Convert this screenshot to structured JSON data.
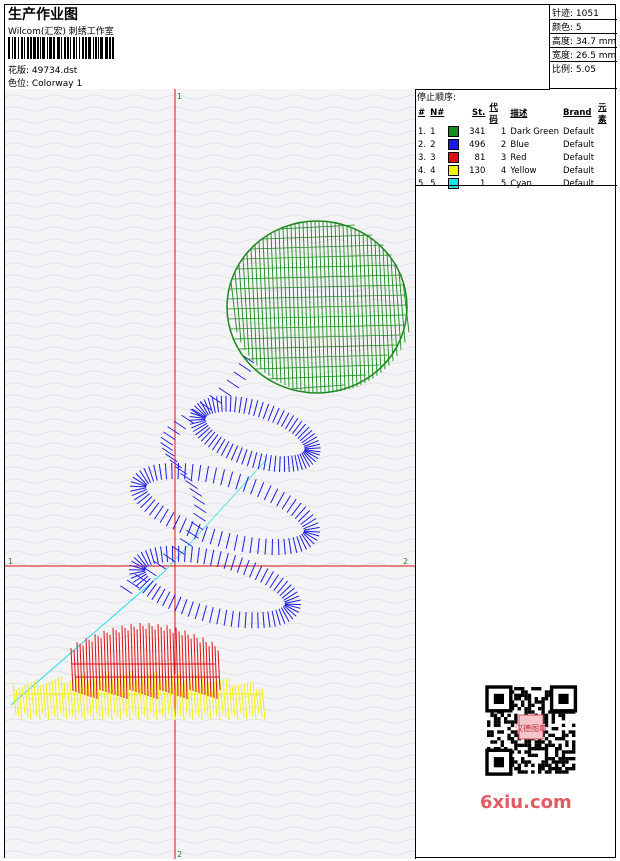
{
  "header": {
    "title": "生产作业图",
    "studio": "Wilcom(汇宏) 刺绣工作室",
    "design_label": "花版: 49734.dst",
    "colorway_label": "色位: Colorway 1"
  },
  "stats": [
    {
      "text": "针迹: 1051"
    },
    {
      "text": "颜色: 5"
    },
    {
      "text": "高度: 34.7 mm"
    },
    {
      "text": "宽度: 26.5 mm"
    },
    {
      "text": "比例: 5.05"
    }
  ],
  "stop_sequence": {
    "title": "停止顺序:",
    "columns": [
      "#",
      "N#",
      "St.",
      "代码",
      "描述",
      "Brand",
      "元素"
    ],
    "rows": [
      {
        "idx": "1.",
        "n": "1",
        "color": "#1a8a1a",
        "st": "341",
        "code": "1",
        "desc": "Dark Green",
        "brand": "Default"
      },
      {
        "idx": "2.",
        "n": "2",
        "color": "#1c1ce0",
        "st": "496",
        "code": "2",
        "desc": "Blue",
        "brand": "Default"
      },
      {
        "idx": "3.",
        "n": "3",
        "color": "#e01010",
        "st": "81",
        "code": "3",
        "desc": "Red",
        "brand": "Default"
      },
      {
        "idx": "4.",
        "n": "4",
        "color": "#f2f20a",
        "st": "130",
        "code": "4",
        "desc": "Yellow",
        "brand": "Default"
      },
      {
        "idx": "5.",
        "n": "5",
        "color": "#22e0e8",
        "st": "1",
        "code": "5",
        "desc": "Cyan",
        "brand": "Default"
      }
    ]
  },
  "axes": {
    "v_top": "1",
    "v_bottom": "2",
    "h_left": "1",
    "h_right": "2"
  },
  "colors": {
    "green": "#1a8a1a",
    "blue": "#1c1ce0",
    "red": "#e01010",
    "yellow": "#f2f20a",
    "cyan": "#22e0e8",
    "axis": "#e01010",
    "brand": "#e25b63"
  },
  "watermark": {
    "text": "6xiu.com",
    "seal": "汉德图章"
  }
}
